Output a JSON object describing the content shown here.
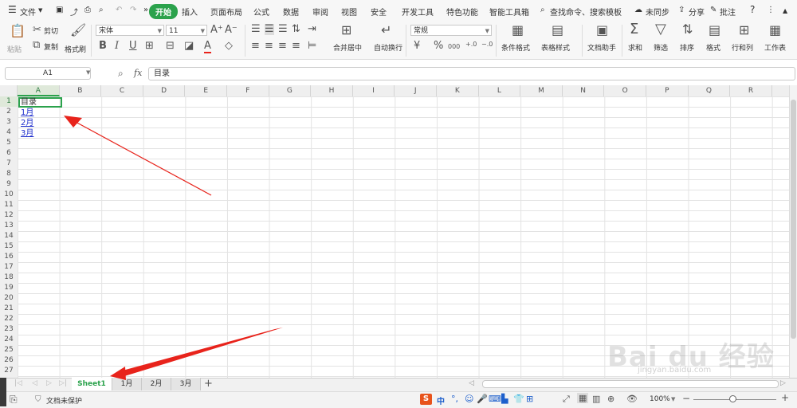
{
  "menu": {
    "hamburger_icon": "menu-icon",
    "file": "文件",
    "tabs": [
      "开始",
      "插入",
      "页面布局",
      "公式",
      "数据",
      "审阅",
      "视图",
      "安全",
      "开发工具",
      "特色功能",
      "智能工具箱"
    ],
    "active_tab": "开始",
    "search": "查找命令、搜索模板",
    "sync": "未同步",
    "share": "分享",
    "comment": "批注",
    "help": "?"
  },
  "ribbon": {
    "paste": "粘贴",
    "cut": "剪切",
    "copy": "复制",
    "format_painter": "格式刷",
    "font_name": "宋体",
    "font_size": "11",
    "bold": "B",
    "italic": "I",
    "underline": "U",
    "font_color_glyph": "A",
    "merge_center": "合并居中",
    "wrap_text": "自动换行",
    "number_format": "常规",
    "percent": "%",
    "thousands": "000",
    "cond_format": "条件格式",
    "table_style": "表格样式",
    "doc_helper": "文档助手",
    "sum": "求和",
    "filter": "筛选",
    "sort": "排序",
    "format": "格式",
    "rows_cols": "行和列",
    "worksheet": "工作表"
  },
  "formula_bar": {
    "name_box": "A1",
    "fx": "fx",
    "content": "目录"
  },
  "columns": [
    "A",
    "B",
    "C",
    "D",
    "E",
    "F",
    "G",
    "H",
    "I",
    "J",
    "K",
    "L",
    "M",
    "N",
    "O",
    "P",
    "Q",
    "R"
  ],
  "rows": [
    "1",
    "2",
    "3",
    "4",
    "5",
    "6",
    "7",
    "8",
    "9",
    "10",
    "11",
    "12",
    "13",
    "14",
    "15",
    "16",
    "17",
    "18",
    "19",
    "20",
    "21",
    "22",
    "23",
    "24",
    "25",
    "26",
    "27"
  ],
  "cells": {
    "a1": "目录",
    "a2": "1月",
    "a3": "2月",
    "a4": "3月"
  },
  "sheet_tabs": [
    "Sheet1",
    "1月",
    "2月",
    "3月"
  ],
  "add_sheet": "+",
  "status": {
    "protect": "文档未保护",
    "ime": "中",
    "zoom": "100%",
    "minus": "−",
    "plus": "+"
  },
  "watermark": {
    "brand": "Bai du 经验",
    "url": "jingyan.baidu.com"
  },
  "colors": {
    "accent": "#2ba24c",
    "link": "#1d2dcc",
    "arrow": "#e8231b"
  }
}
